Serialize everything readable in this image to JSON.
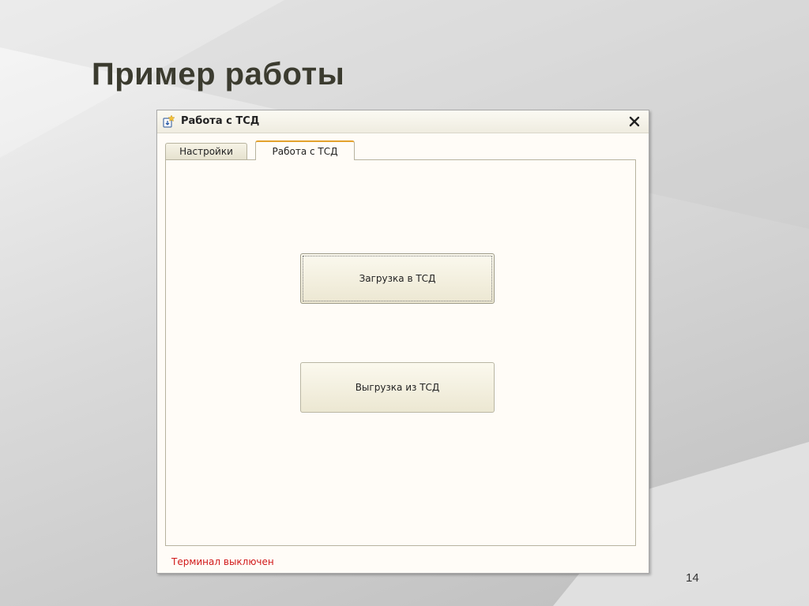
{
  "slide": {
    "title": "Пример работы",
    "page_number": "14"
  },
  "window": {
    "title": "Работа с ТСД",
    "icon": "app-window-icon",
    "close_icon": "close-icon"
  },
  "tabs": [
    {
      "label": "Настройки",
      "active": false
    },
    {
      "label": "Работа с ТСД",
      "active": true
    }
  ],
  "buttons": {
    "upload_label": "Загрузка в ТСД",
    "download_label": "Выгрузка из ТСД"
  },
  "status": {
    "text": "Терминал выключен",
    "color": "#d11a1a"
  },
  "colors": {
    "active_tab_accent": "#e2a12c",
    "window_background": "#fffcf7"
  }
}
